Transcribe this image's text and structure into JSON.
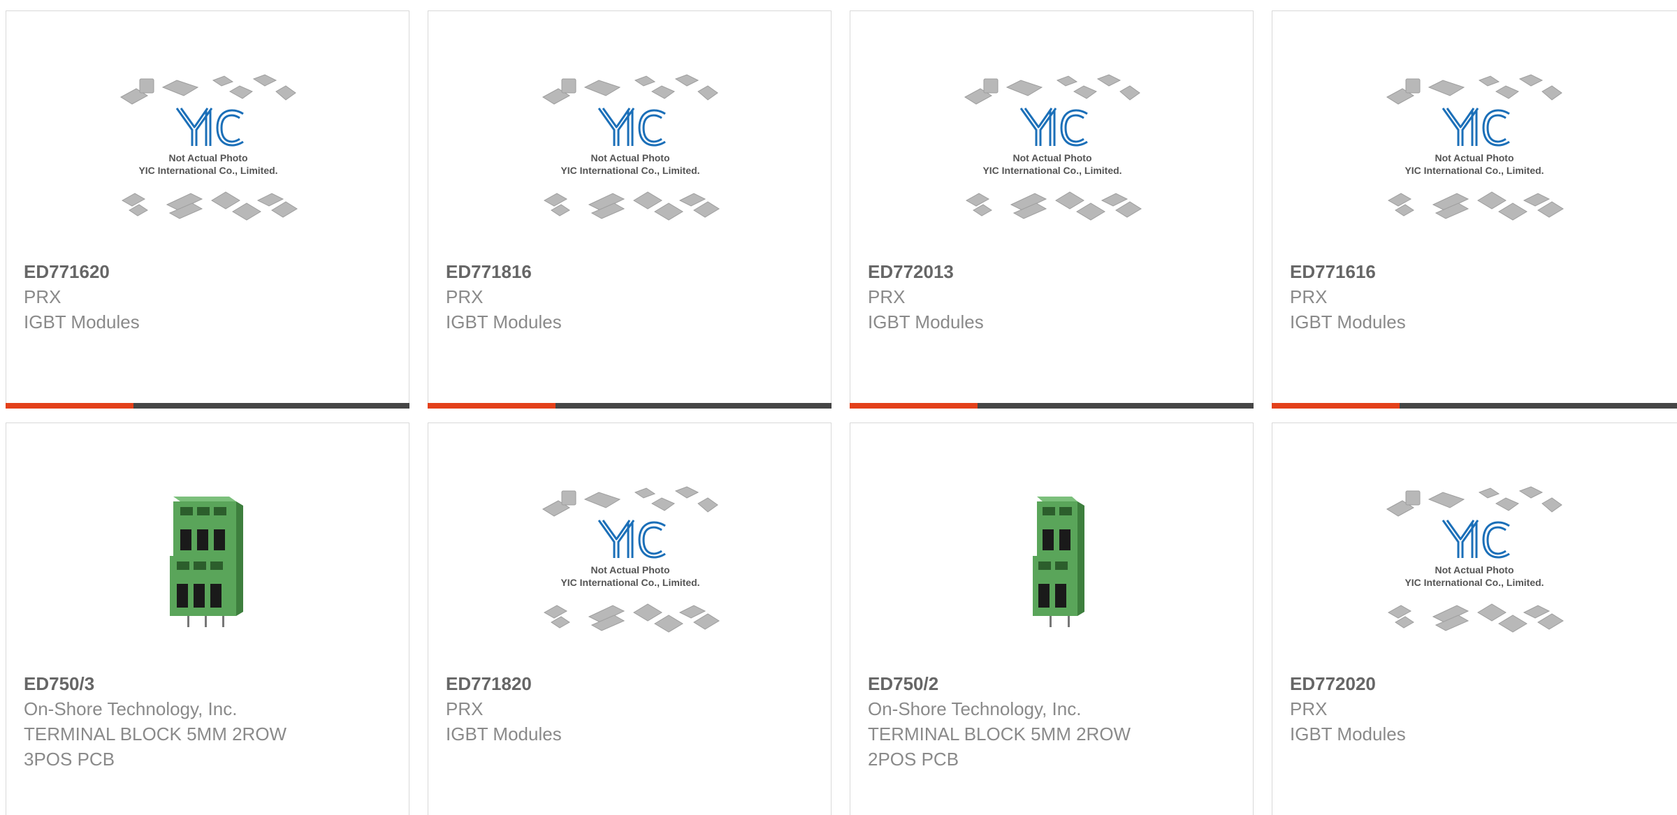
{
  "products": [
    {
      "part_number": "ED771620",
      "manufacturer": "PRX",
      "description": "IGBT Modules",
      "image": "yic-placeholder",
      "placeholder_line1": "Not Actual Photo",
      "placeholder_line2": "YIC International Co., Limited."
    },
    {
      "part_number": "ED771816",
      "manufacturer": "PRX",
      "description": "IGBT Modules",
      "image": "yic-placeholder",
      "placeholder_line1": "Not Actual Photo",
      "placeholder_line2": "YIC International Co., Limited."
    },
    {
      "part_number": "ED772013",
      "manufacturer": "PRX",
      "description": "IGBT Modules",
      "image": "yic-placeholder",
      "placeholder_line1": "Not Actual Photo",
      "placeholder_line2": "YIC International Co., Limited."
    },
    {
      "part_number": "ED771616",
      "manufacturer": "PRX",
      "description": "IGBT Modules",
      "image": "yic-placeholder",
      "placeholder_line1": "Not Actual Photo",
      "placeholder_line2": "YIC International Co., Limited."
    },
    {
      "part_number": "ED750/3",
      "manufacturer": "On-Shore Technology, Inc.",
      "description": "TERMINAL BLOCK 5MM 2ROW 3POS PCB",
      "image": "terminal-block-3pos"
    },
    {
      "part_number": "ED771820",
      "manufacturer": "PRX",
      "description": "IGBT Modules",
      "image": "yic-placeholder",
      "placeholder_line1": "Not Actual Photo",
      "placeholder_line2": "YIC International Co., Limited."
    },
    {
      "part_number": "ED750/2",
      "manufacturer": "On-Shore Technology, Inc.",
      "description": "TERMINAL BLOCK 5MM 2ROW 2POS PCB",
      "image": "terminal-block-2pos"
    },
    {
      "part_number": "ED772020",
      "manufacturer": "PRX",
      "description": "IGBT Modules",
      "image": "yic-placeholder",
      "placeholder_line1": "Not Actual Photo",
      "placeholder_line2": "YIC International Co., Limited."
    }
  ],
  "colors": {
    "accent": "#e3401a",
    "bar": "#454545",
    "logo": "#1b6fb8",
    "terminal_green": "#5aa55a"
  }
}
